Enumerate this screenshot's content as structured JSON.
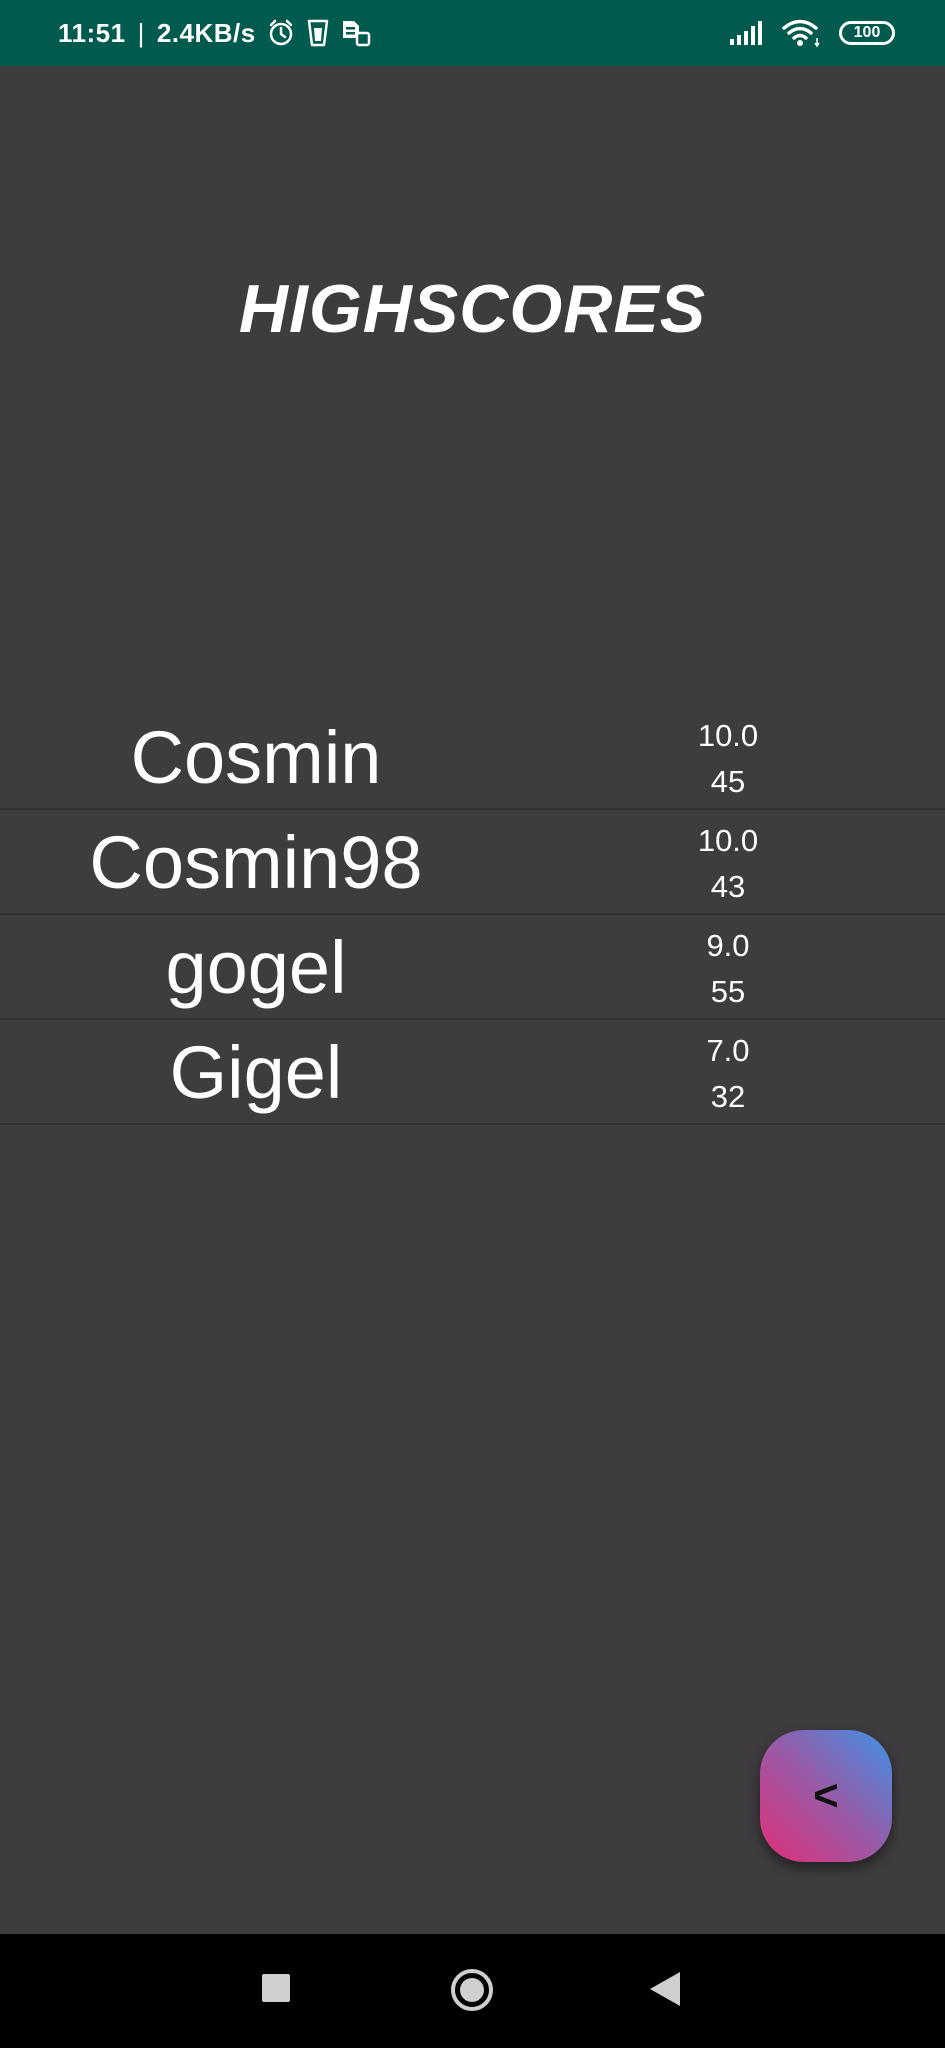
{
  "status_bar": {
    "time": "11:51",
    "separator": "|",
    "network_speed": "2.4KB/s",
    "battery": "100",
    "icons": [
      "alarm-icon",
      "glass-icon",
      "sim-card-icon",
      "signal-icon",
      "wifi-icon",
      "battery-icon"
    ]
  },
  "title": "HIGHSCORES",
  "scores": [
    {
      "name": "Cosmin",
      "score": "10.0",
      "time": "45"
    },
    {
      "name": "Cosmin98",
      "score": "10.0",
      "time": "43"
    },
    {
      "name": "gogel",
      "score": "9.0",
      "time": "55"
    },
    {
      "name": "Gigel",
      "score": "7.0",
      "time": "32"
    }
  ],
  "back_button": {
    "label": "<"
  },
  "colors": {
    "status_bar": "#005a4e",
    "background": "#3e3c3e",
    "divider": "#323032",
    "fab_gradient_start": "#e0307a",
    "fab_gradient_end": "#3f92e8"
  }
}
